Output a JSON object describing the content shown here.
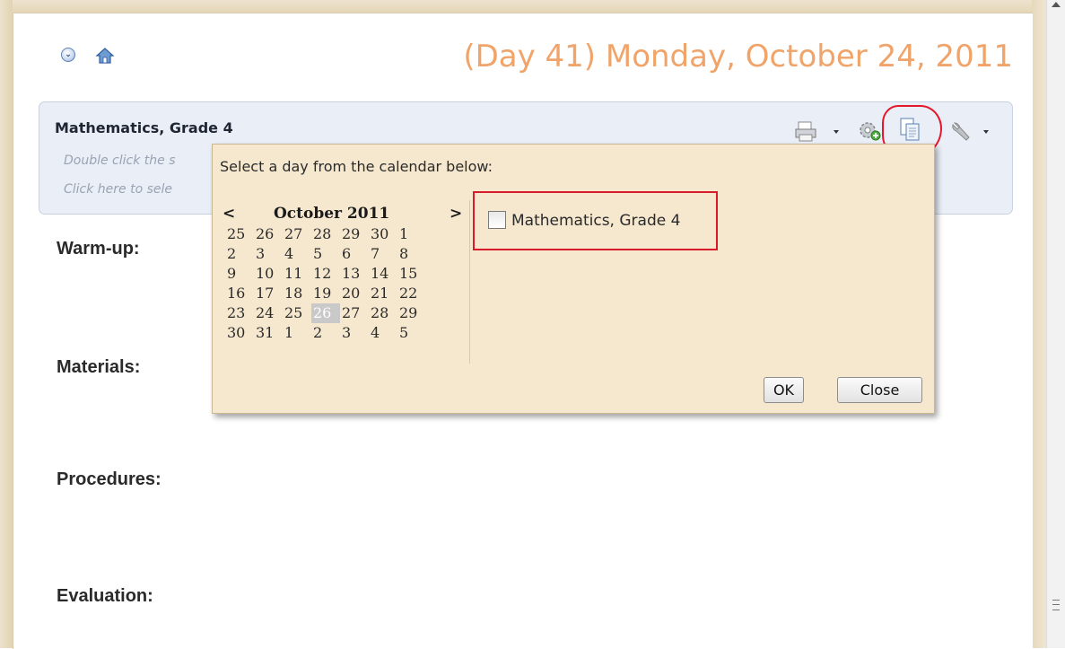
{
  "header": {
    "date_title": "(Day 41) Monday, October 24, 2011"
  },
  "icons": {
    "expand": "circle-chevron-down-icon",
    "home": "home-icon",
    "print": "printer-icon",
    "settings_add": "gear-add-icon",
    "copy": "copy-document-icon",
    "tools": "wrench-icon"
  },
  "course_panel": {
    "title": "Mathematics, Grade 4",
    "hint_1": "Double click the s",
    "hint_2": "Click here to sele"
  },
  "sections": {
    "warmup": "Warm-up:",
    "materials": "Materials:",
    "procedures": "Procedures:",
    "evaluation": "Evaluation:"
  },
  "popup": {
    "prompt": "Select a day from the calendar below:",
    "calendar": {
      "prev": "<",
      "next": ">",
      "month_label": "October 2011",
      "selected_day": "26",
      "weeks": [
        [
          "25",
          "26",
          "27",
          "28",
          "29",
          "30",
          "1"
        ],
        [
          "2",
          "3",
          "4",
          "5",
          "6",
          "7",
          "8"
        ],
        [
          "9",
          "10",
          "11",
          "12",
          "13",
          "14",
          "15"
        ],
        [
          "16",
          "17",
          "18",
          "19",
          "20",
          "21",
          "22"
        ],
        [
          "23",
          "24",
          "25",
          "26",
          "27",
          "28",
          "29"
        ],
        [
          "30",
          "31",
          "1",
          "2",
          "3",
          "4",
          "5"
        ]
      ]
    },
    "course_option": "Mathematics, Grade 4",
    "ok_label": "OK",
    "close_label": "Close"
  },
  "colors": {
    "date_title": "#f0a46a",
    "highlight_red": "#e4182b",
    "popup_bg": "#f6e8cf",
    "panel_bg": "#eaeff7"
  }
}
